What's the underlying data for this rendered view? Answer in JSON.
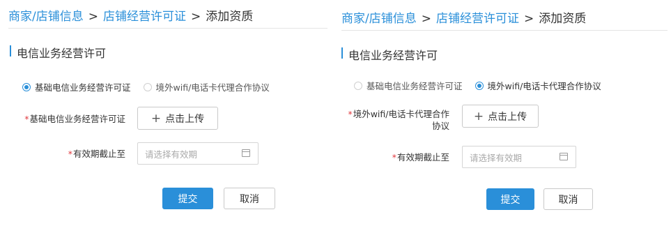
{
  "left": {
    "breadcrumb": {
      "item1": "商家/店铺信息",
      "sep1": ">",
      "item2": "店铺经营许可证",
      "sep2": ">",
      "current": "添加资质"
    },
    "section_title": "电信业务经营许可",
    "radios": [
      {
        "label": "基础电信业务经营许可证",
        "checked": true
      },
      {
        "label": "境外wifi/电话卡代理合作协议",
        "checked": false
      }
    ],
    "cert_label": "基础电信业务经营许可证",
    "upload_label": "点击上传",
    "valid_label": "有效期截止至",
    "date_placeholder": "请选择有效期",
    "submit_label": "提交",
    "cancel_label": "取消"
  },
  "right": {
    "breadcrumb": {
      "item1": "商家/店铺信息",
      "sep1": ">",
      "item2": "店铺经营许可证",
      "sep2": ">",
      "current": "添加资质"
    },
    "section_title": "电信业务经营许可",
    "radios": [
      {
        "label": "基础电信业务经营许可证",
        "checked": false
      },
      {
        "label": "境外wifi/电话卡代理合作协议",
        "checked": true
      }
    ],
    "wifi_label_line1": "境外wifi/电话卡代理合作",
    "wifi_label_line2": "协议",
    "upload_label": "点击上传",
    "valid_label": "有效期截止至",
    "date_placeholder": "请选择有效期",
    "submit_label": "提交",
    "cancel_label": "取消"
  },
  "required_mark": "*",
  "plus_glyph": "+",
  "colors": {
    "accent": "#2a8fd9",
    "required": "#e0393e"
  },
  "icons": {
    "calendar": "calendar-icon",
    "plus": "plus-icon"
  }
}
